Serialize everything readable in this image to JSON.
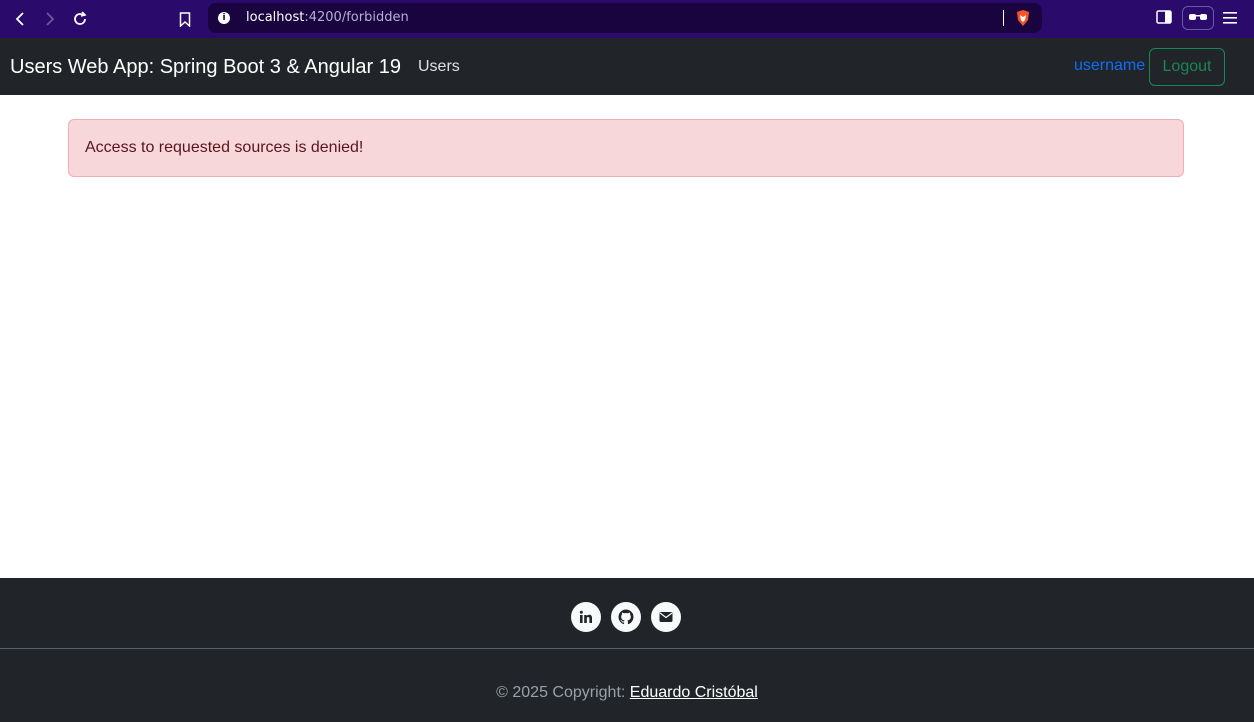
{
  "browser": {
    "url_host": "localhost",
    "url_path": ":4200/forbidden",
    "icons": [
      "back-icon",
      "forward-icon",
      "reload-icon",
      "bookmark-icon",
      "site-info-icon",
      "brave-shield-icon",
      "sidebar-icon",
      "glasses-icon",
      "menu-icon"
    ]
  },
  "navbar": {
    "brand": "Users Web App: Spring Boot 3 & Angular 19",
    "users_link": "Users",
    "username": "username",
    "logout_label": "Logout"
  },
  "alert": {
    "message": "Access to requested sources is denied!"
  },
  "footer": {
    "social_icons": [
      "linkedin-icon",
      "github-icon",
      "email-icon"
    ],
    "copyright_prefix": "© 2025 Copyright: ",
    "author_link": "Eduardo Cristóbal"
  },
  "colors": {
    "browser_bar": "#2a0a6b",
    "navbar_bg": "#212529",
    "username": "#0d6efd",
    "logout": "#198754",
    "alert_bg": "#f8d7da",
    "alert_text": "#58151c"
  }
}
